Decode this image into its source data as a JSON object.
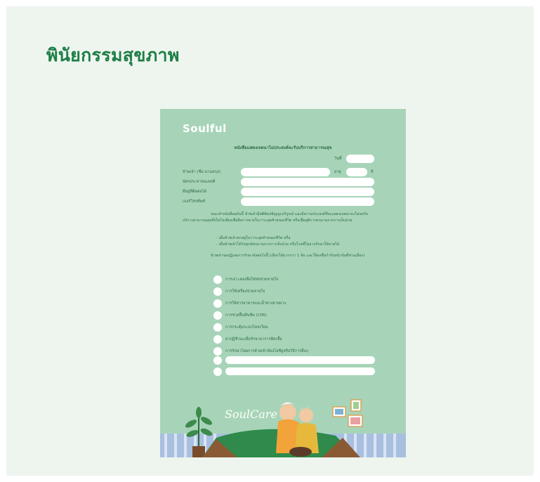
{
  "page": {
    "heading": "พินัยกรรมสุขภาพ"
  },
  "document": {
    "brand": "Soulful",
    "title": "หนังสือแสดงเจตนาไม่ประสงค์จะรับบริการสาธารณสุข",
    "date_label": "วันที่",
    "fields": {
      "name_label": "ข้าพเจ้า (ชื่อ-นามสกุล)",
      "age_label": "อายุ",
      "age_unit": "ปี",
      "id_label": "บัตรประชาชนเลขที่",
      "address_label": "ที่อยู่ที่ติดต่อได้",
      "phone_label": "เบอร์โทรศัพท์"
    },
    "paragraph": "ขณะทำหนังสือฉบับนี้ ข้าพเจ้ามีสติสัมปชัญญะบริบูรณ์ และมีความประสงค์ที่จะแสดงเจตนาจะไม่ขอรับบริการสาธารณสุขที่เป็นไปเพียงเพื่อยืดการตายในวาระสุดท้ายของชีวิต หรือเพื่อยุติการทรมานจากการเจ็บป่วย",
    "conditions": [
      "- เมื่อข้าพเจ้าตกอยู่ในวาระสุดท้ายของชีวิต หรือ",
      "- เมื่อข้าพเจ้าได้รับทุกข์ทรมานจากการเจ็บป่วย หรือโรคที่ไม่อาจรักษาให้หายได้"
    ],
    "instruction": "ข้าพเจ้าขอปฏิเสธการรักษาดังต่อไปนี้ (เลือกได้มากกว่า 1 ข้อ และให้ลงชื่อกำกับหน้าข้อที่ท่านเลือก)",
    "options": [
      "การเจาะคอเพื่อใส่ท่อช่วยหายใจ",
      "การใช้เครื่องช่วยหายใจ",
      "การให้สารอาหารและน้ำทางสายยาง",
      "การช่วยฟื้นคืนชีพ (CPR)",
      "การกระตุ้นระบบไหลเวียน",
      "ยาปฏิชีวนะเพื่อรักษาอาการติดเชื้อ",
      "การรักษาโดยการย้ายเข้าห้องไอซียูหรือวิธีการอื่นๆ"
    ],
    "art_text": "SoulCare"
  },
  "colors": {
    "accent": "#1e7e46",
    "doc_bg": "#a7d4b8",
    "panel_bg": "#eef5ef"
  }
}
